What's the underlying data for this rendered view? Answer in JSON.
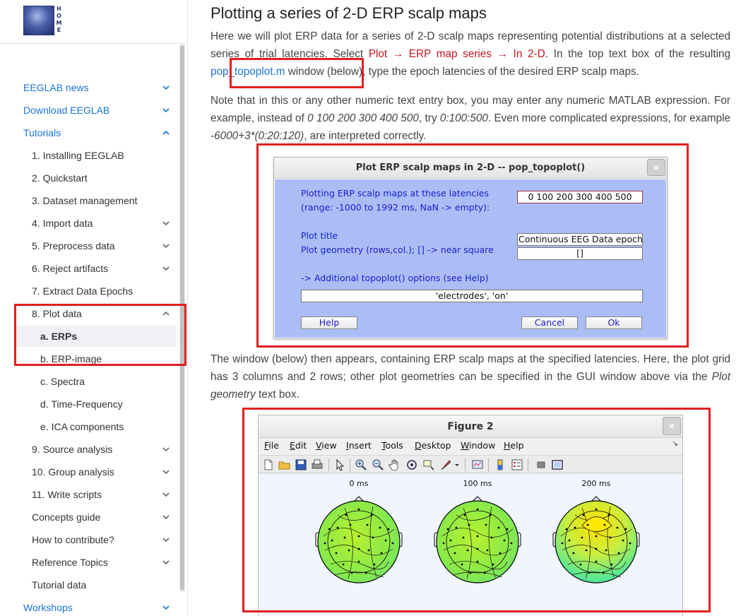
{
  "sidebar": {
    "logo_text": "HOME",
    "items": [
      {
        "label": "EEGLAB news",
        "level": "top",
        "chevron": "down"
      },
      {
        "label": "Download EEGLAB",
        "level": "top",
        "chevron": "down"
      },
      {
        "label": "Tutorials",
        "level": "top",
        "chevron": "up"
      },
      {
        "label": "1. Installing EEGLAB",
        "level": "sub",
        "chevron": ""
      },
      {
        "label": "2. Quickstart",
        "level": "sub",
        "chevron": ""
      },
      {
        "label": "3. Dataset management",
        "level": "sub",
        "chevron": ""
      },
      {
        "label": "4. Import data",
        "level": "sub",
        "chevron": "down"
      },
      {
        "label": "5. Preprocess data",
        "level": "sub",
        "chevron": "down"
      },
      {
        "label": "6. Reject artifacts",
        "level": "sub",
        "chevron": "down"
      },
      {
        "label": "7. Extract Data Epochs",
        "level": "sub",
        "chevron": ""
      },
      {
        "label": "8. Plot data",
        "level": "sub",
        "chevron": "up"
      },
      {
        "label": "a. ERPs",
        "level": "sub2",
        "chevron": "",
        "active": true
      },
      {
        "label": "b. ERP-image",
        "level": "sub2",
        "chevron": ""
      },
      {
        "label": "c. Spectra",
        "level": "sub2",
        "chevron": ""
      },
      {
        "label": "d. Time-Frequency",
        "level": "sub2",
        "chevron": ""
      },
      {
        "label": "e. ICA components",
        "level": "sub2",
        "chevron": ""
      },
      {
        "label": "9. Source analysis",
        "level": "sub",
        "chevron": "down"
      },
      {
        "label": "10. Group analysis",
        "level": "sub",
        "chevron": "down"
      },
      {
        "label": "11. Write scripts",
        "level": "sub",
        "chevron": "down"
      },
      {
        "label": "Concepts guide",
        "level": "sub",
        "chevron": "down"
      },
      {
        "label": "How to contribute?",
        "level": "sub",
        "chevron": "down"
      },
      {
        "label": "Reference Topics",
        "level": "sub",
        "chevron": "down"
      },
      {
        "label": "Tutorial data",
        "level": "sub",
        "chevron": ""
      },
      {
        "label": "Workshops",
        "level": "top",
        "chevron": "down"
      }
    ]
  },
  "content": {
    "title": "Plotting a series of 2-D ERP scalp maps",
    "p1_a": "Here we will plot ERP data for a series of 2-D scalp maps representing potential distributions at a selected series of trial latencies. Select ",
    "p1_menu": "Plot → ERP map series → In 2-D",
    "p1_b": ". In the top text box of the resulting ",
    "p1_link": "pop_topoplot.m",
    "p1_c": " window (below), type the epoch latencies of the desired ERP scalp maps.",
    "p2_a": "Note that in this or any other numeric text entry box, you may enter any numeric MATLAB expression. For example, instead of ",
    "p2_i1": "0 100 200 300 400 500",
    "p2_b": ", try ",
    "p2_i2": "0:100:500",
    "p2_c": ". Even more complicated expressions, for example ",
    "p2_i3": "-6000+3*(0:20:120)",
    "p2_d": ", are interpreted correctly.",
    "p3_a": "The window (below) then appears, containing ERP scalp maps at the specified latencies. Here, the plot grid has 3 columns and 2 rows; other plot geometries can be specified in the GUI window above via the ",
    "p3_i": "Plot geometry",
    "p3_b": " text box."
  },
  "dialog": {
    "title": "Plot ERP scalp maps in 2-D -- pop_topoplot()",
    "close": "×",
    "latency_label_1": "Plotting ERP scalp maps at these latencies",
    "latency_label_2": "(range: -1000 to 1992 ms, NaN -> empty):",
    "latency_value": "0 100 200 300 400 500",
    "plot_title_label": "Plot title",
    "plot_title_value": "Continuous EEG Data epoch",
    "geometry_label": "Plot geometry (rows,col.); [] -> near square",
    "geometry_value": "[]",
    "options_label": "-> Additional topoplot() options (see Help)",
    "options_value": "'electrodes', 'on'",
    "help_button": "Help",
    "cancel_button": "Cancel",
    "ok_button": "Ok"
  },
  "figure": {
    "title": "Figure 2",
    "close": "×",
    "menus": [
      {
        "u": "F",
        "rest": "ile"
      },
      {
        "u": "E",
        "rest": "dit"
      },
      {
        "u": "V",
        "rest": "iew"
      },
      {
        "u": "I",
        "rest": "nsert"
      },
      {
        "u": "T",
        "rest": "ools"
      },
      {
        "u": "D",
        "rest": "esktop"
      },
      {
        "u": "W",
        "rest": "indow"
      },
      {
        "u": "H",
        "rest": "elp"
      }
    ],
    "dock_icon": "↘",
    "maps": [
      {
        "label": "0 ms",
        "scheme": "green"
      },
      {
        "label": "100 ms",
        "scheme": "green"
      },
      {
        "label": "200 ms",
        "scheme": "yellow"
      }
    ]
  }
}
